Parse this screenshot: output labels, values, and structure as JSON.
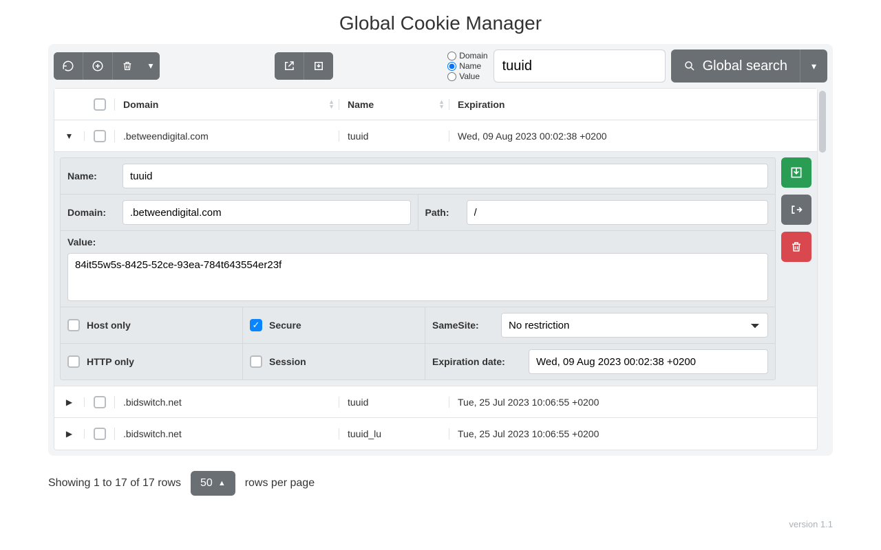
{
  "title": "Global Cookie Manager",
  "search": {
    "radios": {
      "domain": "Domain",
      "name": "Name",
      "value": "Value",
      "selected": "name"
    },
    "value": "tuuid",
    "button": "Global search"
  },
  "columns": {
    "domain": "Domain",
    "name": "Name",
    "expiration": "Expiration"
  },
  "rows": [
    {
      "domain": ".betweendigital.com",
      "name": "tuuid",
      "expiration": "Wed, 09 Aug 2023 00:02:38 +0200",
      "expanded": true
    },
    {
      "domain": ".bidswitch.net",
      "name": "tuuid",
      "expiration": "Tue, 25 Jul 2023 10:06:55 +0200",
      "expanded": false
    },
    {
      "domain": ".bidswitch.net",
      "name": "tuuid_lu",
      "expiration": "Tue, 25 Jul 2023 10:06:55 +0200",
      "expanded": false
    }
  ],
  "detail": {
    "labels": {
      "name": "Name:",
      "domain": "Domain:",
      "path": "Path:",
      "value": "Value:",
      "host_only": "Host only",
      "secure": "Secure",
      "samesite": "SameSite:",
      "http_only": "HTTP only",
      "session": "Session",
      "exp_date": "Expiration date:"
    },
    "name": "tuuid",
    "domain": ".betweendigital.com",
    "path": "/",
    "value": "84it55w5s-8425-52ce-93ea-784t643554er23f",
    "host_only": false,
    "secure": true,
    "http_only": false,
    "session": false,
    "samesite": "No restriction",
    "exp_date": "Wed, 09 Aug 2023 00:02:38 +0200"
  },
  "footer": {
    "showing": "Showing 1 to 17 of 17 rows",
    "page_size": "50",
    "rows_per_page": "rows per page"
  },
  "version": "version 1.1"
}
